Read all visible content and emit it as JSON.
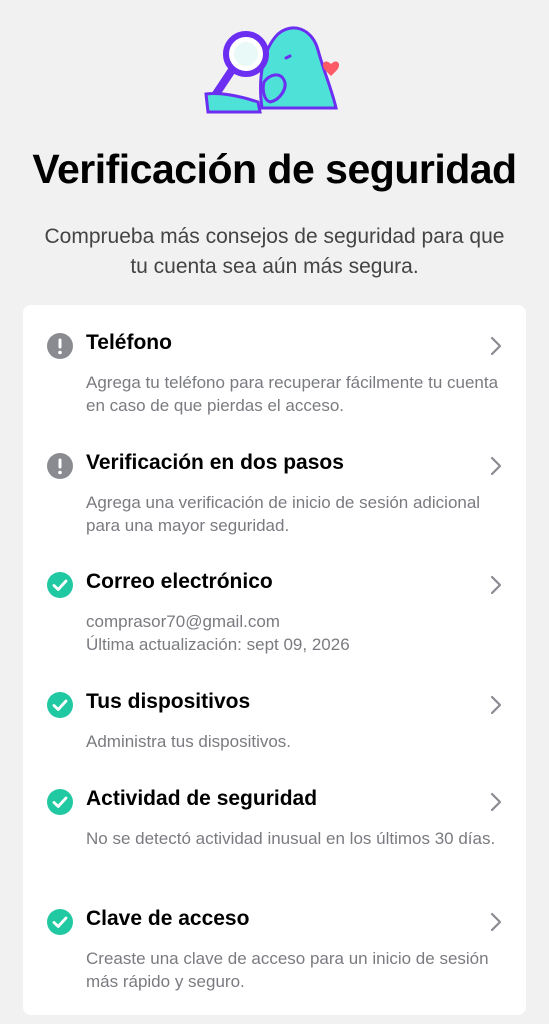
{
  "header": {
    "title": "Verificación de seguridad",
    "subtitle": "Comprueba más consejos de seguridad para que tu cuenta sea aún más segura.",
    "illustration_icon": "magnifying-glass-character-heart"
  },
  "colors": {
    "ok": "#20c9a1",
    "warn": "#8a8b91",
    "illustration_teal": "#4ee1d8",
    "illustration_purple": "#6c2ef0",
    "heart": "#fd5a67"
  },
  "items": [
    {
      "status": "warning",
      "title": "Teléfono",
      "desc": "Agrega tu teléfono para recuperar fácilmente tu cuenta en caso de que pierdas el acceso.",
      "desc2": ""
    },
    {
      "status": "warning",
      "title": "Verificación en dos pasos",
      "desc": "Agrega una verificación de inicio de sesión adicional para una mayor seguridad.",
      "desc2": ""
    },
    {
      "status": "ok",
      "title": "Correo electrónico",
      "desc": "comprasor70@gmail.com",
      "desc2": "Última actualización: sept 09, 2026"
    },
    {
      "status": "ok",
      "title": "Tus dispositivos",
      "desc": "Administra tus dispositivos.",
      "desc2": ""
    },
    {
      "status": "ok",
      "title": "Actividad de seguridad",
      "desc": "No se detectó actividad inusual en los últimos 30 días.",
      "desc2": ""
    },
    {
      "status": "ok",
      "title": "Clave de acceso",
      "desc": "Creaste una clave de acceso para un inicio de sesión más rápido y seguro.",
      "desc2": ""
    }
  ]
}
